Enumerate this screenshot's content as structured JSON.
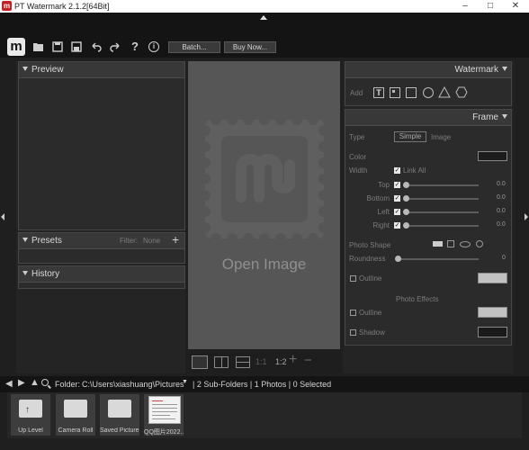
{
  "window": {
    "title": "PT Watermark 2.1.2[64Bit]",
    "app_icon": "m",
    "minimize_glyph": "–",
    "maximize_glyph": "□",
    "close_glyph": "✕"
  },
  "toolbar": {
    "logo": "m",
    "help_glyph": "?",
    "info_glyph": "i",
    "batch_label": "Batch...",
    "buy_label": "Buy Now...",
    "icons": [
      "folder-open-icon",
      "save-icon",
      "save-as-icon",
      "undo-icon",
      "redo-icon",
      "help-icon",
      "info-icon"
    ]
  },
  "left_panel": {
    "preview": {
      "title": "Preview"
    },
    "presets": {
      "title": "Presets",
      "filter_label": "Filter:",
      "filter_value": "None",
      "add_glyph": "+"
    },
    "history": {
      "title": "History"
    }
  },
  "center": {
    "open_image": "Open Image",
    "zoom_1": "1:1",
    "zoom_2": "1:2",
    "zoom_in": "+",
    "zoom_out": "−"
  },
  "right_panel": {
    "watermark": {
      "title": "Watermark",
      "add_label": "Add"
    },
    "frame": {
      "title": "Frame",
      "type_label": "Type",
      "type_simple": "Simple",
      "type_image": "Image",
      "color_label": "Color",
      "color_value": "#1c1c1c",
      "width_label": "Width",
      "link_all": "Link All",
      "sliders": [
        {
          "label": "Top",
          "value": "0.0"
        },
        {
          "label": "Bottom",
          "value": "0.0"
        },
        {
          "label": "Left",
          "value": "0.0"
        },
        {
          "label": "Right",
          "value": "0.0"
        }
      ],
      "photo_shape_label": "Photo Shape",
      "roundness_label": "Roundness",
      "roundness_value": "0",
      "outline_label": "Outline",
      "outline_color": "#c2c2c2",
      "photo_effects_label": "Photo Effects",
      "effects_outline_label": "Outline",
      "effects_outline_color": "#c2c2c2",
      "shadow_label": "Shadow",
      "shadow_color": "#1a1a1a"
    }
  },
  "folder_bar": {
    "label": "Folder:",
    "path": "C:\\Users\\xiashuang\\Pictures",
    "info": "| 2 Sub-Folders | 1 Photos | 0 Selected"
  },
  "filmstrip": [
    {
      "label": "Up Level"
    },
    {
      "label": "Camera Roll"
    },
    {
      "label": "Saved Pictures"
    },
    {
      "label": "QQ图片2022..."
    }
  ]
}
